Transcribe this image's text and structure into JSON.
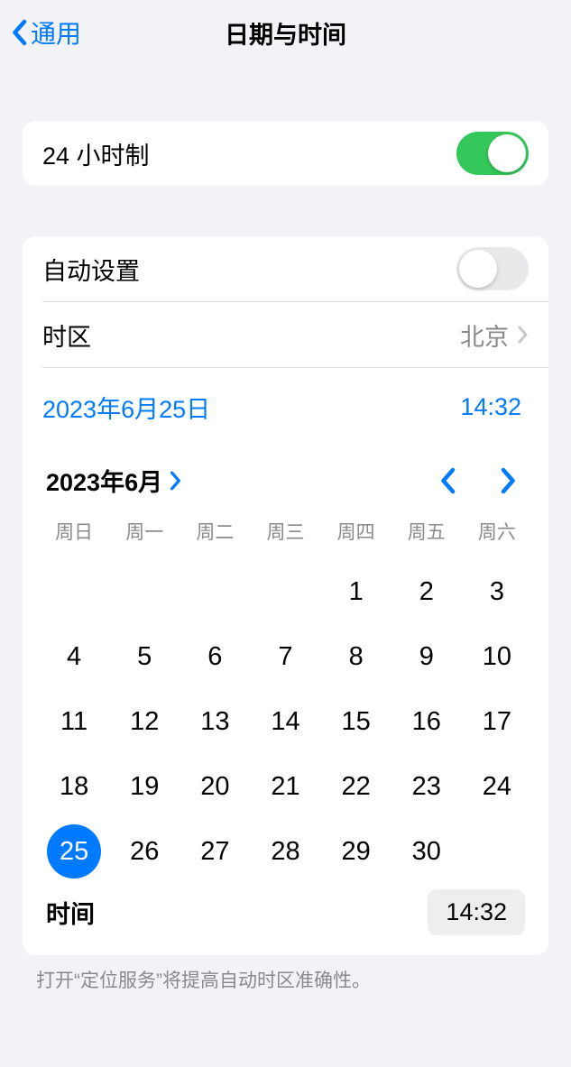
{
  "header": {
    "back_label": "通用",
    "title": "日期与时间"
  },
  "settings": {
    "twentyfour_hour_label": "24 小时制",
    "auto_set_label": "自动设置",
    "timezone_label": "时区",
    "timezone_value": "北京"
  },
  "datetime": {
    "date_display": "2023年6月25日",
    "time_display": "14:32"
  },
  "calendar": {
    "month_label": "2023年6月",
    "weekdays": [
      "周日",
      "周一",
      "周二",
      "周三",
      "周四",
      "周五",
      "周六"
    ],
    "first_weekday": 4,
    "days_in_month": 30,
    "selected_day": 25,
    "time_label": "时间",
    "time_value": "14:32"
  },
  "footer_note": "打开“定位服务”将提高自动时区准确性。"
}
